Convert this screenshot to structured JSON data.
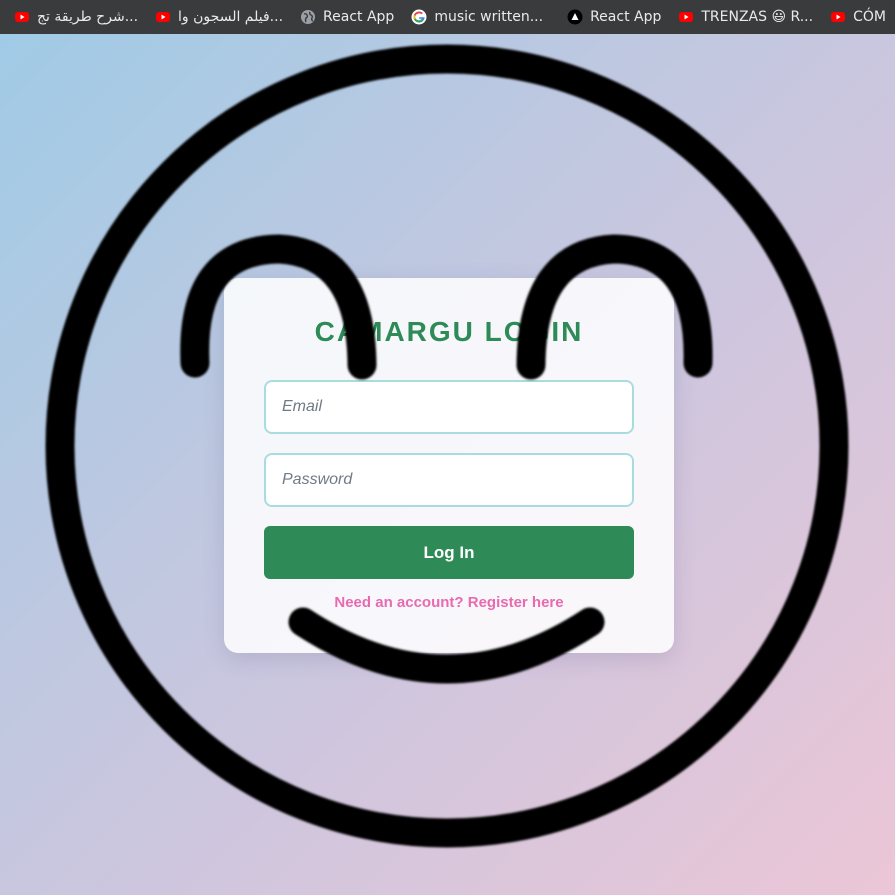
{
  "bookmarks": [
    {
      "icon": "youtube-icon",
      "label": "شرح طريقة تج..."
    },
    {
      "icon": "youtube-icon",
      "label": "فيلم السجون وا..."
    },
    {
      "icon": "globe-icon",
      "label": "React App"
    },
    {
      "icon": "google-icon",
      "label": "music written..."
    },
    {
      "icon": "app-triangle-icon",
      "label": "React App"
    },
    {
      "icon": "youtube-icon",
      "label": "TRENZAS 😃 R..."
    },
    {
      "icon": "youtube-icon",
      "label": "CÓM"
    }
  ],
  "colors": {
    "accent": "#2e8b57",
    "link": "#e86ab0",
    "field_border": "#a8dde0",
    "youtube_red": "#ff0000"
  },
  "login": {
    "title": "CAMARGU LOGIN",
    "email_placeholder": "Email",
    "password_placeholder": "Password",
    "submit_label": "Log In",
    "register_text": "Need an account? Register here"
  }
}
